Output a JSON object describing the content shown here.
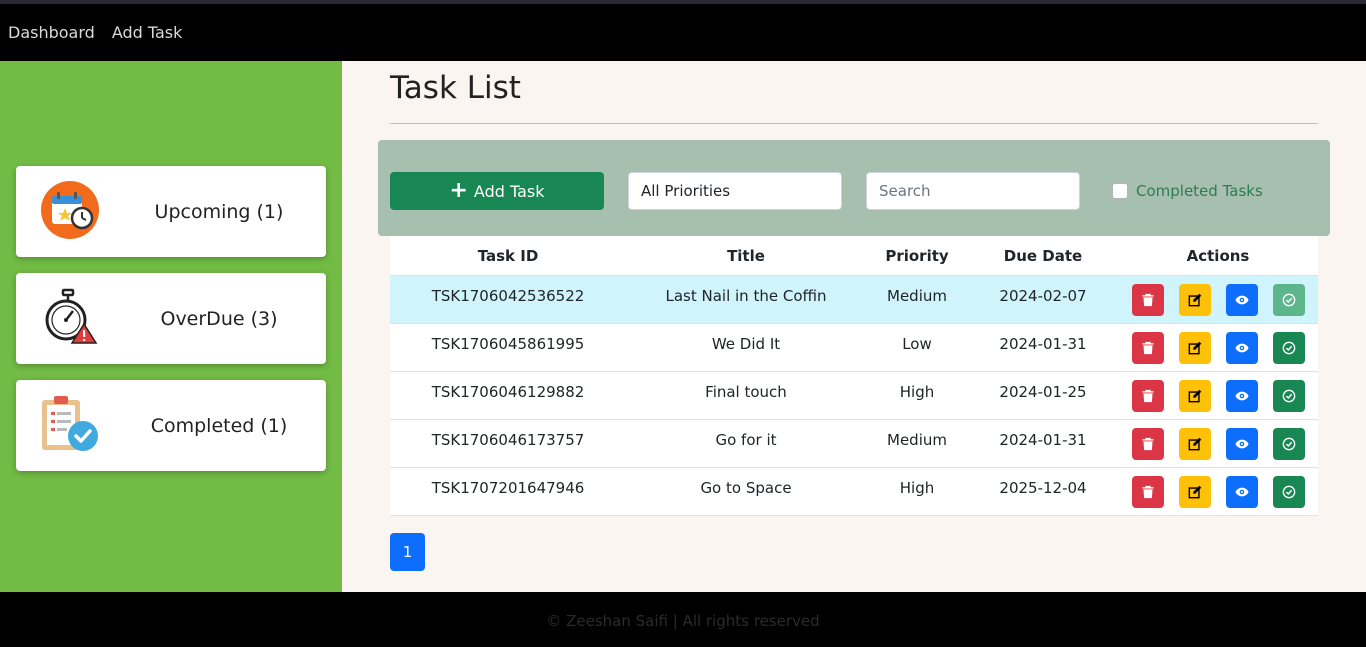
{
  "nav": {
    "links": [
      "Dashboard",
      "Add Task"
    ]
  },
  "sidebar": {
    "cards": [
      {
        "label": "Upcoming (1)",
        "icon": "calendar-clock-icon"
      },
      {
        "label": "OverDue (3)",
        "icon": "stopwatch-warning-icon"
      },
      {
        "label": "Completed (1)",
        "icon": "clipboard-check-icon"
      }
    ]
  },
  "main": {
    "title": "Task List",
    "toolbar": {
      "add_label": "Add Task",
      "priority_selected": "All Priorities",
      "search_placeholder": "Search",
      "completed_label": "Completed Tasks",
      "completed_checked": false
    },
    "table": {
      "headers": [
        "Task ID",
        "Title",
        "Priority",
        "Due Date",
        "Actions"
      ],
      "rows": [
        {
          "id": "TSK1706042536522",
          "title": "Last Nail in the Coffin",
          "priority": "Medium",
          "due": "2024-02-07",
          "highlight": true
        },
        {
          "id": "TSK1706045861995",
          "title": "We Did It",
          "priority": "Low",
          "due": "2024-01-31",
          "highlight": false
        },
        {
          "id": "TSK1706046129882",
          "title": "Final touch",
          "priority": "High",
          "due": "2024-01-25",
          "highlight": false
        },
        {
          "id": "TSK1706046173757",
          "title": "Go for it",
          "priority": "Medium",
          "due": "2024-01-31",
          "highlight": false
        },
        {
          "id": "TSK1707201647946",
          "title": "Go to Space",
          "priority": "High",
          "due": "2025-12-04",
          "highlight": false
        }
      ]
    },
    "pagination": {
      "current": "1"
    }
  },
  "footer": {
    "text": "© Zeeshan Saifi | All rights reserved"
  },
  "colors": {
    "sidebar": "#72bb45",
    "toolbar": "#a6bfae",
    "primary": "#0d6efd",
    "success": "#198754",
    "danger": "#dc3545",
    "warning": "#ffc107",
    "highlight_row": "#cff4fc"
  }
}
